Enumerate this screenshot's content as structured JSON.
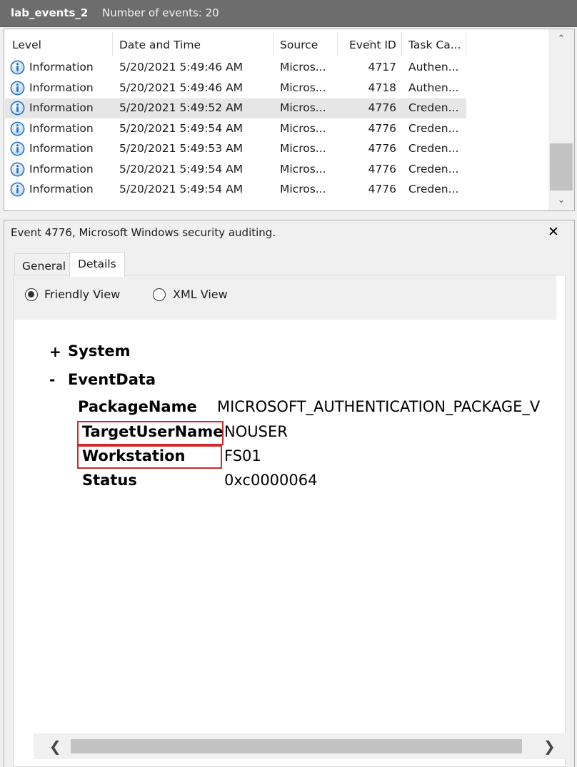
{
  "window": {
    "log_name": "lab_events_2",
    "event_count_label": "Number of events: 20"
  },
  "list": {
    "columns": [
      "Level",
      "Date and Time",
      "Source",
      "Event ID",
      "Task Ca..."
    ],
    "rows": [
      {
        "level": "Information",
        "datetime": "5/20/2021 5:49:46 AM",
        "source": "Micros...",
        "event_id": "4717",
        "task": "Authen..."
      },
      {
        "level": "Information",
        "datetime": "5/20/2021 5:49:46 AM",
        "source": "Micros...",
        "event_id": "4718",
        "task": "Authen..."
      },
      {
        "level": "Information",
        "datetime": "5/20/2021 5:49:52 AM",
        "source": "Micros...",
        "event_id": "4776",
        "task": "Creden..."
      },
      {
        "level": "Information",
        "datetime": "5/20/2021 5:49:54 AM",
        "source": "Micros...",
        "event_id": "4776",
        "task": "Creden..."
      },
      {
        "level": "Information",
        "datetime": "5/20/2021 5:49:53 AM",
        "source": "Micros...",
        "event_id": "4776",
        "task": "Creden..."
      },
      {
        "level": "Information",
        "datetime": "5/20/2021 5:49:54 AM",
        "source": "Micros...",
        "event_id": "4776",
        "task": "Creden..."
      },
      {
        "level": "Information",
        "datetime": "5/20/2021 5:49:54 AM",
        "source": "Micros...",
        "event_id": "4776",
        "task": "Creden..."
      }
    ],
    "selected_row_index": 2
  },
  "details": {
    "title": "Event 4776, Microsoft Windows security auditing.",
    "tabs": {
      "general": "General",
      "details": "Details"
    },
    "active_tab": "Details",
    "view_options": {
      "friendly": "Friendly View",
      "xml": "XML View"
    },
    "selected_view": "Friendly View",
    "tree": {
      "system": {
        "sign": "+",
        "label": "System"
      },
      "eventdata": {
        "sign": "-",
        "label": "EventData"
      }
    },
    "fields": [
      {
        "key": "PackageName",
        "value": "MICROSOFT_AUTHENTICATION_PACKAGE_V"
      },
      {
        "key": "TargetUserName",
        "value": "NOUSER"
      },
      {
        "key": "Workstation",
        "value": "FS01"
      },
      {
        "key": "Status",
        "value": "0xc0000064"
      }
    ],
    "highlighted_fields": [
      "TargetUserName",
      "Workstation"
    ],
    "highlight_color": "#d12a2a"
  },
  "icons": {
    "level_info": "info-icon",
    "close": "close-icon",
    "scroll_up": "chevron-up-icon",
    "scroll_down": "chevron-down-icon",
    "scroll_left": "chevron-left-icon",
    "scroll_right": "chevron-right-icon"
  },
  "colors": {
    "titlebar": "#6d6d6d",
    "selected_row": "#e6e6e6",
    "info_icon": "#1e6fc7"
  }
}
